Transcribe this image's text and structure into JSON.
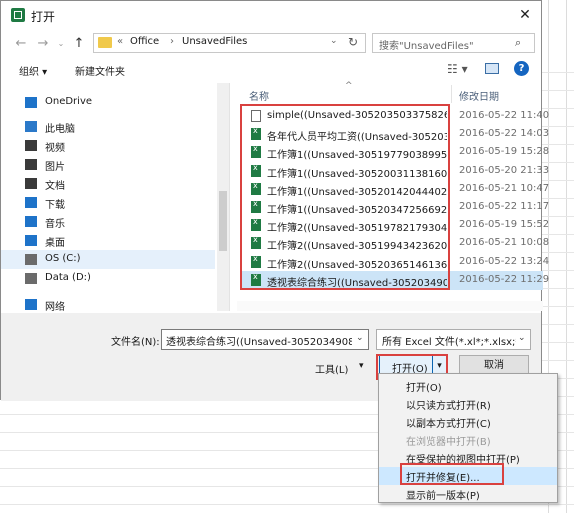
{
  "dialog": {
    "title": "打开",
    "close_glyph": "✕"
  },
  "address": {
    "back_glyph": "←",
    "forward_glyph": "→",
    "recent_glyph": "⌄",
    "up_glyph": "↑",
    "prefix_chevron": "«",
    "segments": [
      "Office",
      "UnsavedFiles"
    ],
    "separator": "›",
    "dropdown_glyph": "⌄",
    "refresh_glyph": "↻"
  },
  "search": {
    "placeholder": "搜索\"UnsavedFiles\"",
    "icon_glyph": "⌕"
  },
  "toolbar": {
    "organize": "组织 ▾",
    "new_folder": "新建文件夹",
    "view_glyph": "☷ ▾",
    "help_glyph": "?"
  },
  "nav": {
    "items": [
      {
        "label": "OneDrive",
        "icon": "cloud-icon",
        "color": "#1e73c9"
      },
      {
        "label": "此电脑",
        "icon": "computer-icon",
        "color": "#2b79c9"
      },
      {
        "label": "视频",
        "icon": "video-icon",
        "color": "#3a3a3a"
      },
      {
        "label": "图片",
        "icon": "picture-icon",
        "color": "#3a3a3a"
      },
      {
        "label": "文档",
        "icon": "document-icon",
        "color": "#3a3a3a"
      },
      {
        "label": "下载",
        "icon": "download-icon",
        "color": "#1e73c9"
      },
      {
        "label": "音乐",
        "icon": "music-icon",
        "color": "#1e73c9"
      },
      {
        "label": "桌面",
        "icon": "desktop-icon",
        "color": "#1e73c9"
      },
      {
        "label": "OS (C:)",
        "icon": "drive-icon",
        "color": "#6b6b6b"
      },
      {
        "label": "Data (D:)",
        "icon": "drive-icon",
        "color": "#6b6b6b"
      },
      {
        "label": "网络",
        "icon": "network-icon",
        "color": "#1e73c9"
      }
    ],
    "selected_index": 8
  },
  "list": {
    "col_name": "名称",
    "col_date": "修改日期",
    "sort_glyph": "^",
    "files": [
      {
        "name": "simple((Unsaved-305203503375826…",
        "date": "2016-05-22 11:40",
        "icon": "document-icon"
      },
      {
        "name": "各年代人员平均工资((Unsaved-305203…",
        "date": "2016-05-22 14:03",
        "icon": "excel-file-icon"
      },
      {
        "name": "工作簿1((Unsaved-305197790389952…",
        "date": "2016-05-19 15:28",
        "icon": "excel-file-icon"
      },
      {
        "name": "工作簿1((Unsaved-305200311381600…",
        "date": "2016-05-20 21:33",
        "icon": "excel-file-icon"
      },
      {
        "name": "工作簿1((Unsaved-305201420444025…",
        "date": "2016-05-21 10:47",
        "icon": "excel-file-icon"
      },
      {
        "name": "工作簿1((Unsaved-305203472566923…",
        "date": "2016-05-22 11:17",
        "icon": "excel-file-icon"
      },
      {
        "name": "工作簿2((Unsaved-305197821793048…",
        "date": "2016-05-19 15:52",
        "icon": "excel-file-icon"
      },
      {
        "name": "工作簿2((Unsaved-305199434236200…",
        "date": "2016-05-21 10:08",
        "icon": "excel-file-icon"
      },
      {
        "name": "工作簿2((Unsaved-305203651461360…",
        "date": "2016-05-22 13:24",
        "icon": "excel-file-icon"
      },
      {
        "name": "透视表综合练习((Unsaved-3052034908…",
        "date": "2016-05-22 11:29",
        "icon": "excel-file-icon"
      }
    ],
    "selected_index": 9
  },
  "bottom": {
    "filename_label": "文件名(N):",
    "filename_value": "透视表综合练习((Unsaved-3052034908238",
    "filetype_value": "所有 Excel 文件(*.xl*;*.xlsx;*.xl",
    "dropdown_glyph": "⌄",
    "tools_label": "工具(L)",
    "tools_dd_glyph": "▾",
    "open_label": "打开(O)",
    "open_dd_glyph": "▾",
    "cancel_label": "取消"
  },
  "open_menu": {
    "items": [
      {
        "label": "打开(O)",
        "enabled": true
      },
      {
        "label": "以只读方式打开(R)",
        "enabled": true
      },
      {
        "label": "以副本方式打开(C)",
        "enabled": true
      },
      {
        "label": "在浏览器中打开(B)",
        "enabled": false
      },
      {
        "label": "在受保护的视图中打开(P)",
        "enabled": true
      },
      {
        "label": "打开并修复(E)...",
        "enabled": true
      },
      {
        "label": "显示前一版本(P)",
        "enabled": true
      }
    ],
    "hover_index": 5
  },
  "colors": {
    "highlight_red": "#d9413f",
    "selection_blue": "#cce4f7",
    "excel_green": "#1f7a43"
  }
}
